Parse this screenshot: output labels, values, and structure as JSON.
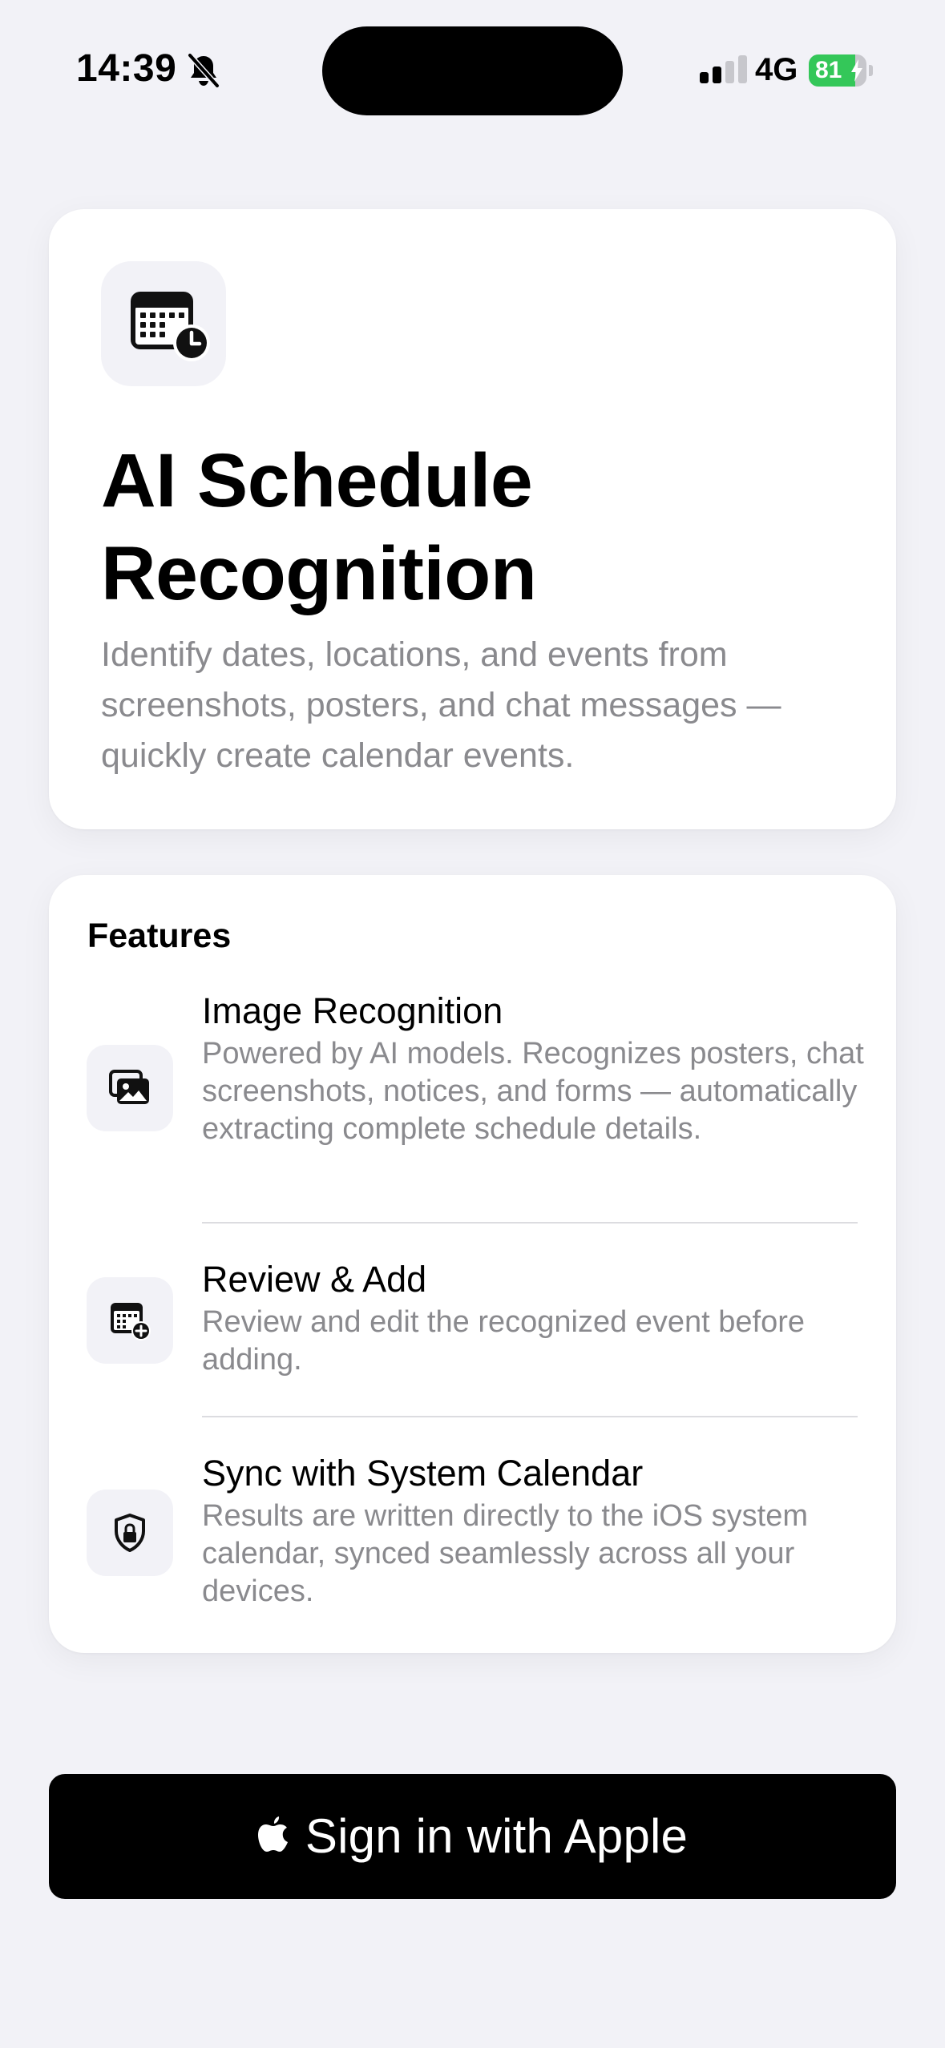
{
  "status_bar": {
    "time": "14:39",
    "network": "4G",
    "battery_percent": "81",
    "battery_level": 0.81,
    "icons": [
      "bell-slash-icon",
      "signal-bars-icon",
      "battery-charging-icon"
    ]
  },
  "hero": {
    "icon": "calendar-clock-icon",
    "title": "AI Schedule Recognition",
    "subtitle": "Identify dates, locations, and events from screenshots, posters, and chat messages — quickly create calendar events."
  },
  "features": {
    "heading": "Features",
    "items": [
      {
        "icon": "photos-icon",
        "title": "Image Recognition",
        "description": "Powered by AI models. Recognizes posters, chat screenshots, notices, and forms — automatically extracting complete schedule details."
      },
      {
        "icon": "calendar-add-icon",
        "title": "Review & Add",
        "description": "Review and edit the recognized event before adding."
      },
      {
        "icon": "lock-shield-icon",
        "title": "Sync with System Calendar",
        "description": "Results are written directly to the iOS system calendar, synced seamlessly across all your devices."
      }
    ]
  },
  "sign_in": {
    "label": "Sign in with Apple",
    "icon": "apple-logo-icon"
  },
  "colors": {
    "background": "#F2F2F7",
    "card": "#FFFFFF",
    "secondary_text": "#8A8A8E",
    "battery_green": "#34C759",
    "button": "#000000"
  }
}
